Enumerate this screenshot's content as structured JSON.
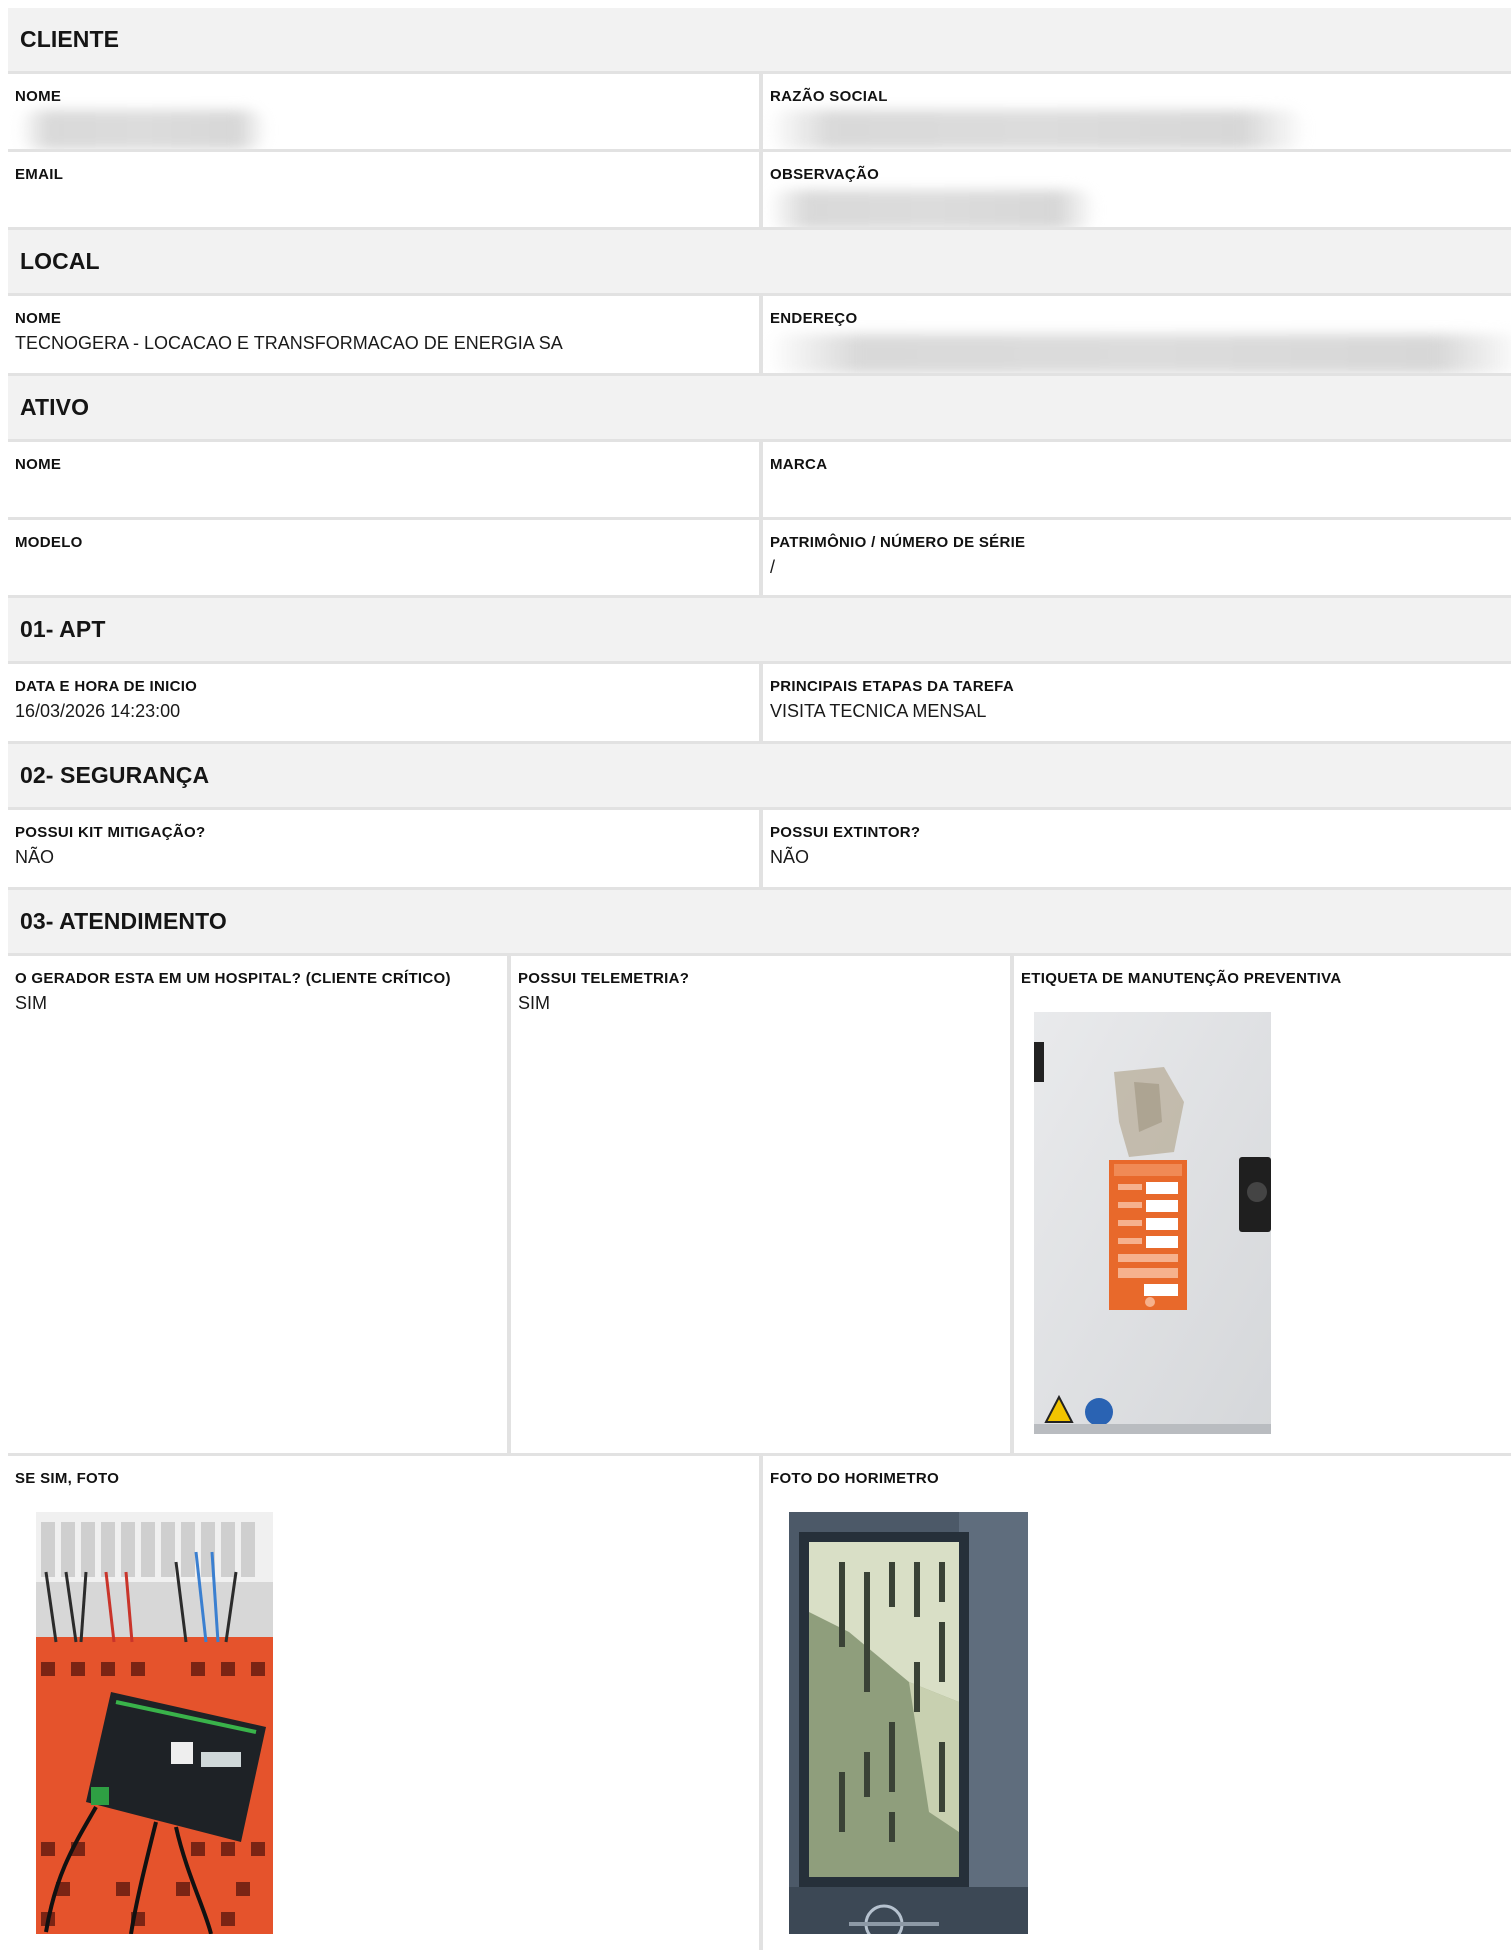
{
  "cliente": {
    "heading": "CLIENTE",
    "nome_label": "NOME",
    "nome_value": "",
    "razao_label": "RAZÃO SOCIAL",
    "razao_value": "",
    "email_label": "EMAIL",
    "email_value": "",
    "obs_label": "OBSERVAÇÃO",
    "obs_value": ""
  },
  "local": {
    "heading": "LOCAL",
    "nome_label": "NOME",
    "nome_value": "TECNOGERA - LOCACAO E TRANSFORMACAO DE ENERGIA SA",
    "endereco_label": "ENDEREÇO",
    "endereco_value": ""
  },
  "ativo": {
    "heading": "ATIVO",
    "nome_label": "NOME",
    "nome_value": "",
    "marca_label": "MARCA",
    "marca_value": "",
    "modelo_label": "MODELO",
    "modelo_value": "",
    "patrimonio_label": "PATRIMÔNIO / NÚMERO DE SÉRIE",
    "patrimonio_value": "/"
  },
  "apt": {
    "heading": "01- APT",
    "inicio_label": "DATA E HORA DE INICIO",
    "inicio_value": "16/03/2026 14:23:00",
    "etapas_label": "PRINCIPAIS ETAPAS DA TAREFA",
    "etapas_value": "VISITA TECNICA MENSAL"
  },
  "seguranca": {
    "heading": "02- SEGURANÇA",
    "kit_label": "POSSUI KIT MITIGAÇÃO?",
    "kit_value": "NÃO",
    "extintor_label": "POSSUI EXTINTOR?",
    "extintor_value": "NÃO"
  },
  "atendimento": {
    "heading": "03- ATENDIMENTO",
    "hospital_label": "O GERADOR ESTA EM UM HOSPITAL? (CLIENTE CRÍTICO)",
    "hospital_value": "SIM",
    "telemetria_label": "POSSUI TELEMETRIA?",
    "telemetria_value": "SIM",
    "etiqueta_label": "ETIQUETA DE MANUTENÇÃO PREVENTIVA",
    "foto_label": "SE SIM, FOTO",
    "horimetro_label": "FOTO DO HORIMETRO"
  },
  "colors": {
    "section_bg": "#f2f2f2",
    "divider": "#e2e2e2",
    "label_orange": "#e8692b",
    "panel_orange": "#e5532c"
  }
}
